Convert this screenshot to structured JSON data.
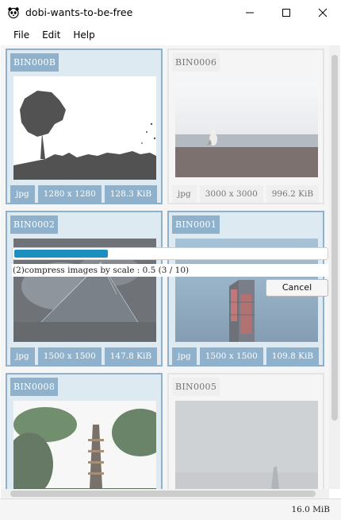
{
  "window": {
    "title": "dobi-wants-to-be-free",
    "icons": [
      "panda-app-icon",
      "minimize-icon",
      "maximize-icon",
      "close-icon"
    ]
  },
  "menu": {
    "file": "File",
    "edit": "Edit",
    "help": "Help"
  },
  "cards": [
    {
      "id": "BIN000B",
      "format": "jpg",
      "dims": "1280 x 1280",
      "size": "128.3 KiB",
      "selected": true
    },
    {
      "id": "BIN0006",
      "format": "jpg",
      "dims": "3000 x 3000",
      "size": "996.2 KiB",
      "selected": false
    },
    {
      "id": "BIN0002",
      "format": "jpg",
      "dims": "1500 x 1500",
      "size": "147.8 KiB",
      "selected": true
    },
    {
      "id": "BIN0001",
      "format": "jpg",
      "dims": "1500 x 1500",
      "size": "109.8 KiB",
      "selected": true
    },
    {
      "id": "BIN0008",
      "selected": true
    },
    {
      "id": "BIN0005",
      "selected": false
    }
  ],
  "progress": {
    "text": "(2)compress images by scale : 0.5 (3 / 10)",
    "fraction": 0.3,
    "cancel_label": "Cancel"
  },
  "status": {
    "total_size": "16.0 MiB"
  },
  "colors": {
    "selected_border": "#5a8db3",
    "progress": "#1a8fc0"
  }
}
